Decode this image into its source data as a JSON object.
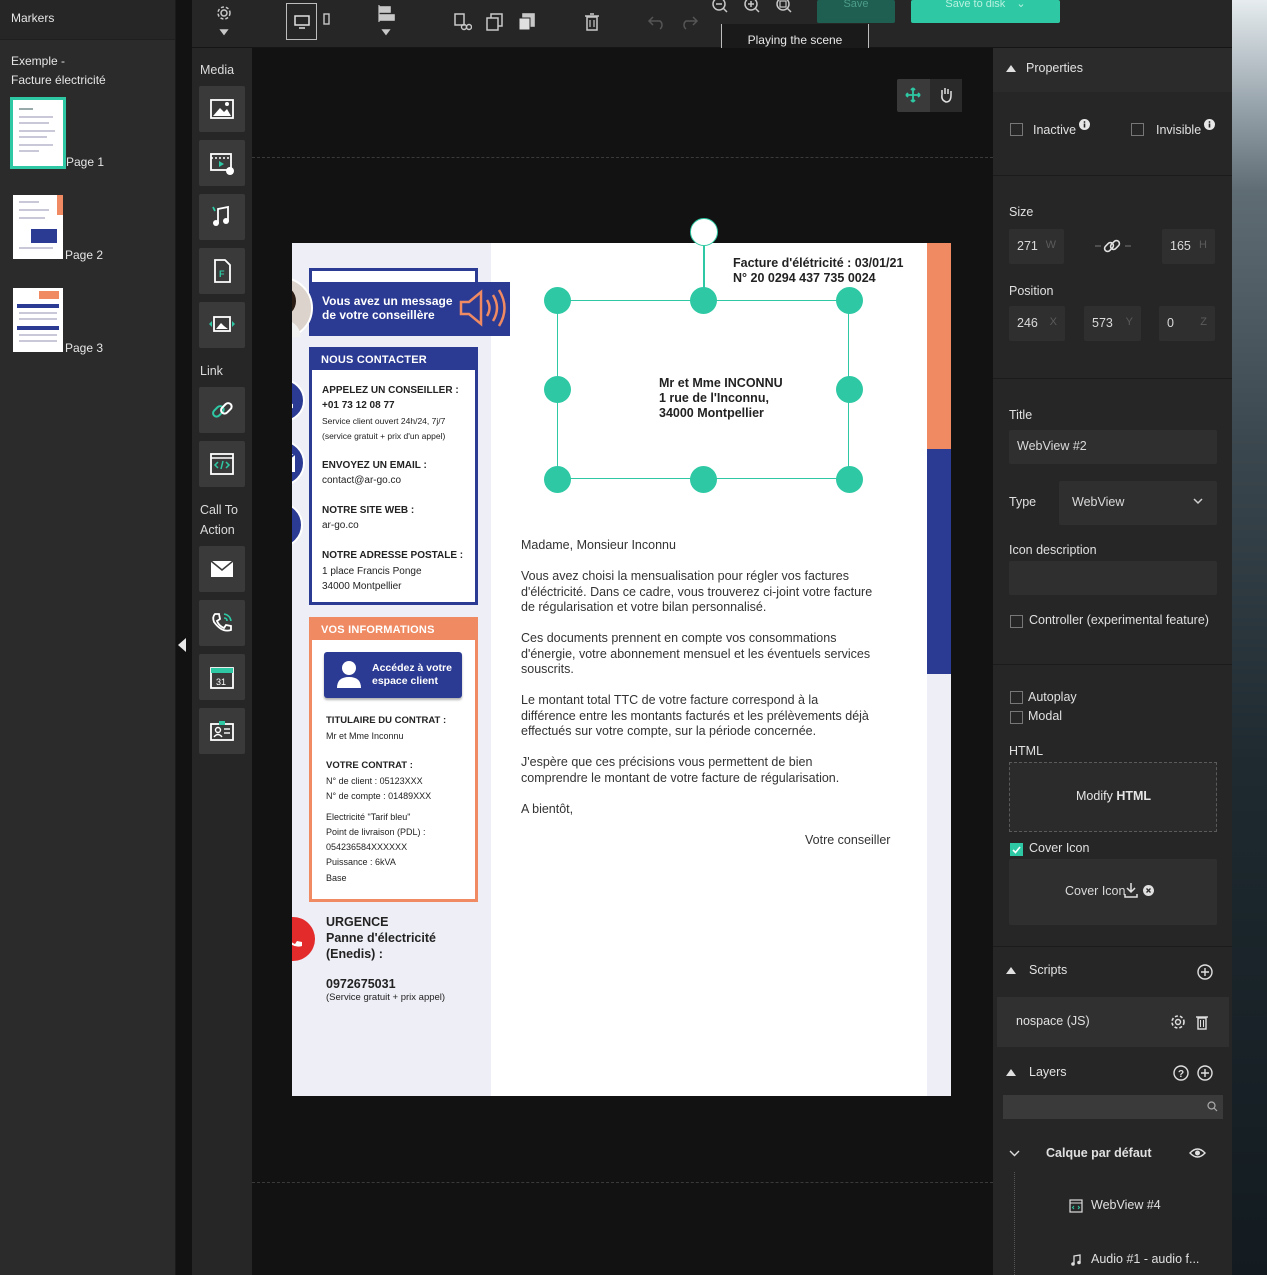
{
  "markers_panel": {
    "header": "Markers",
    "document_title": "Exemple - Facture électricité",
    "pages": [
      {
        "label": "Page 1",
        "selected": true
      },
      {
        "label": "Page 2",
        "selected": false
      },
      {
        "label": "Page 3",
        "selected": false
      }
    ]
  },
  "toolbar": {
    "settings_icon": "gear-icon",
    "save_label": "Save",
    "save_to_disk_label": "Save to disk",
    "tooltip": "Playing the scene",
    "accent_color": "#2ec9a4"
  },
  "sidebar": {
    "categories": {
      "media": "Media",
      "link": "Link",
      "cta": "Call To Action"
    },
    "media_tools": [
      "image-icon",
      "video-icon",
      "audio-icon",
      "file-icon",
      "gallery-icon"
    ],
    "link_tools": [
      "link-icon",
      "webview-icon"
    ],
    "cta_tools": [
      "email-icon",
      "phone-icon",
      "calendar-icon",
      "contact-card-icon"
    ]
  },
  "document": {
    "advisor_message": "Vous avez un message de votre conseillère",
    "contact": {
      "header": "NOUS CONTACTER",
      "call_title": "APPELEZ UN CONSEILLER :",
      "call_number": "+01 73 12 08 77",
      "call_note_1": "Service client ouvert 24h/24, 7j/7",
      "call_note_2": "(service gratuit + prix d'un appel)",
      "email_title": "ENVOYEZ UN EMAIL :",
      "email_value": "contact@ar-go.co",
      "web_title": "NOTRE SITE WEB :",
      "web_value": "ar-go.co",
      "address_title": "NOTRE ADRESSE POSTALE :",
      "address_line1": "1 place Francis Ponge",
      "address_line2": "34000 Montpellier"
    },
    "info": {
      "header": "VOS INFORMATIONS",
      "button": "Accédez à votre espace client",
      "holder_title": "TITULAIRE DU CONTRAT :",
      "holder_value": "Mr et Mme Inconnu",
      "contract_title": "VOTRE CONTRAT :",
      "client_no": "N° de client : 05123XXX",
      "account_no": "N° de compte : 01489XXX",
      "tariff": "Electricité \"Tarif bleu\"",
      "pdl_label": "Point de livraison (PDL) :",
      "pdl_value": "054236584XXXXXX",
      "power": "Puissance : 6kVA",
      "base": "Base"
    },
    "urgence": {
      "title": "URGENCE",
      "line1": "Panne d'électricité",
      "line2": "(Enedis) :",
      "number": "0972675031",
      "note": "(Service gratuit + prix appel)"
    },
    "invoice_title": "Facture d'élétricité : 03/01/21",
    "invoice_number": "N° 20 0294 437 735 0024",
    "recipient": {
      "line1": "Mr et Mme INCONNU",
      "line2": "1 rue de l'Inconnu,",
      "line3": "34000 Montpellier"
    },
    "letter": {
      "greeting": "Madame, Monsieur Inconnu",
      "p1": [
        "Vous avez choisi la mensualisation pour régler vos factures",
        "d'éléctricité. Dans ce cadre, vous trouverez ci-joint votre facture",
        "de régularisation et votre bilan personnalisé."
      ],
      "p2": [
        "Ces documents prennent en compte vos consommations",
        "d'énergie, votre abonnement mensuel et les éventuels services",
        "souscrits."
      ],
      "p3": [
        "Le montant total TTC de votre facture correspond à la",
        "différence entre les montants facturés et les prélèvements déjà",
        "effectués sur votre compte, sur la période concernée."
      ],
      "p4": [
        "J'espère que ces précisions vous permettent de bien",
        "comprendre le montant de votre facture de régularisation."
      ],
      "closing": "A bientôt,",
      "signature": "Votre conseiller"
    },
    "colors": {
      "navy": "#2b3a92",
      "orange": "#ef8a62",
      "lavender": "#eeeef7"
    }
  },
  "properties": {
    "section_title": "Properties",
    "inactive_label": "Inactive",
    "invisible_label": "Invisible",
    "size_label": "Size",
    "width": "271",
    "width_unit": "W",
    "height": "165",
    "height_unit": "H",
    "position_label": "Position",
    "pos_x": "246",
    "pos_x_unit": "X",
    "pos_y": "573",
    "pos_y_unit": "Y",
    "pos_z": "0",
    "pos_z_unit": "Z",
    "title_label": "Title",
    "title_value": "WebView #2",
    "type_label": "Type",
    "type_value": "WebView",
    "icon_desc_label": "Icon description",
    "icon_desc_value": "",
    "controller_label": "Controller (experimental feature)",
    "autoplay_label": "Autoplay",
    "modal_label": "Modal",
    "html_label": "HTML",
    "modify_html_prefix": "Modify",
    "modify_html_bold": "HTML",
    "cover_icon_label": "Cover Icon",
    "cover_icon_checked": true,
    "cover_icon_button": "Cover Icon"
  },
  "scripts": {
    "section_title": "Scripts",
    "items": [
      {
        "name": "nospace (JS)"
      }
    ]
  },
  "layers": {
    "section_title": "Layers",
    "search_placeholder": "",
    "group_name": "Calque par défaut",
    "items": [
      {
        "name": "WebView #4",
        "icon": "webview-icon"
      },
      {
        "name": "Audio #1 - audio f...",
        "icon": "audio-icon"
      }
    ]
  }
}
